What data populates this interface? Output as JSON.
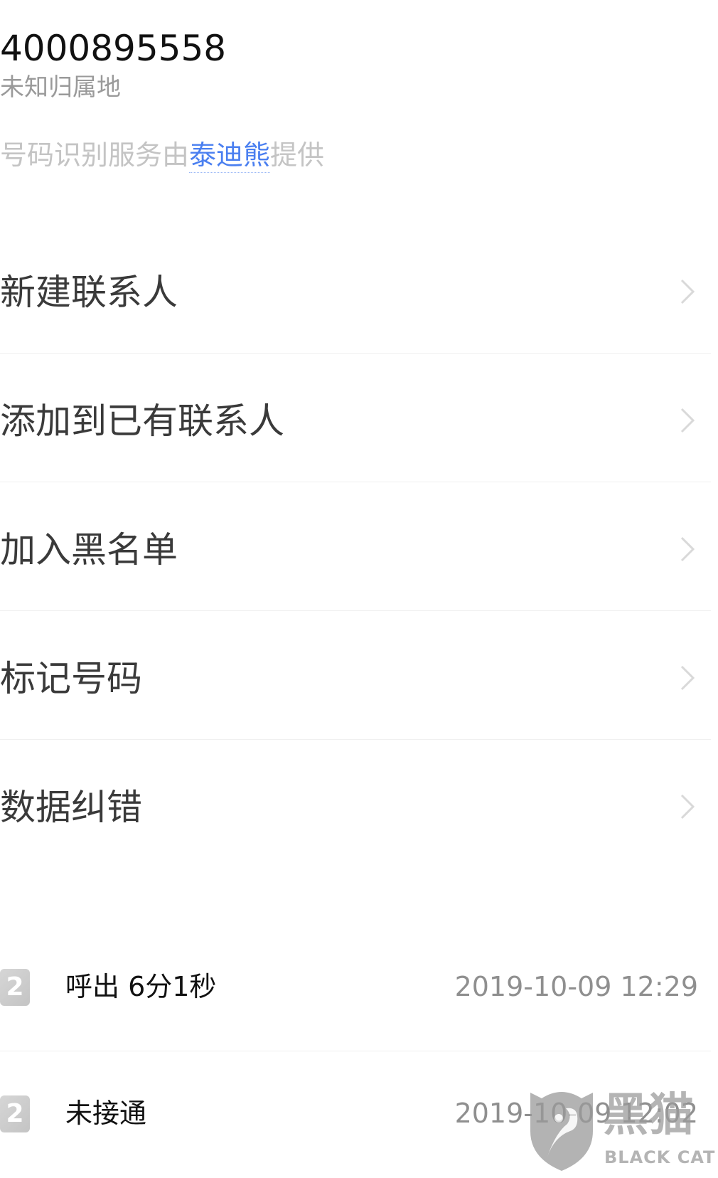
{
  "header": {
    "phone_number": "4000895558",
    "location": "未知归属地",
    "provider_prefix": "号码识别服务由",
    "provider_link": "泰迪熊",
    "provider_suffix": "提供",
    "link_color": "#4a7ff0"
  },
  "menu": {
    "items": [
      {
        "label": "新建联系人",
        "icon": "chevron-right-icon"
      },
      {
        "label": "添加到已有联系人",
        "icon": "chevron-right-icon"
      },
      {
        "label": "加入黑名单",
        "icon": "chevron-right-icon"
      },
      {
        "label": "标记号码",
        "icon": "chevron-right-icon"
      },
      {
        "label": "数据纠错",
        "icon": "chevron-right-icon"
      }
    ]
  },
  "call_log": {
    "entries": [
      {
        "sim": "2",
        "description": "呼出 6分1秒",
        "time": "2019-10-09 12:29"
      },
      {
        "sim": "2",
        "description": "未接通",
        "time": "2019-10-09 12:02"
      }
    ]
  },
  "watermark": {
    "cn": "黑猫",
    "en": "BLACK CAT"
  }
}
